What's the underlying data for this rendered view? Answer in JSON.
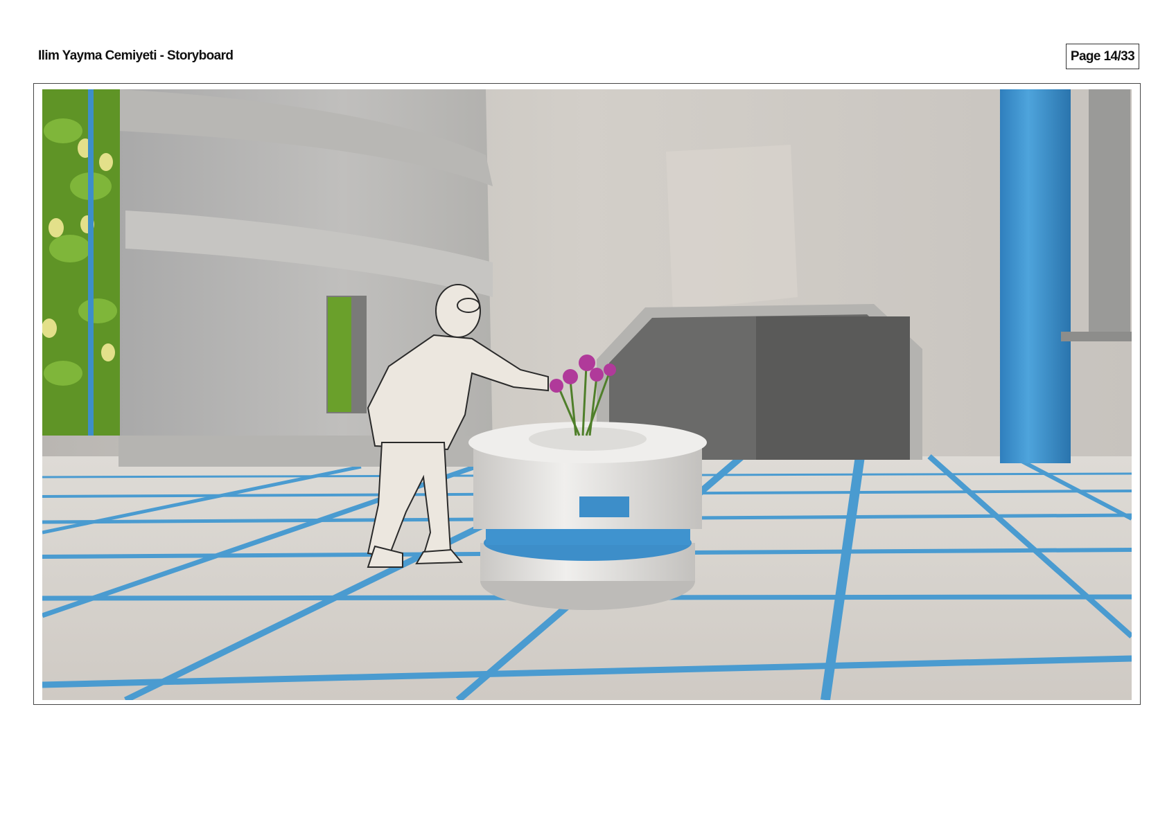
{
  "header": {
    "title": "Ilim Yayma Cemiyeti - Storyboard",
    "page_indicator": "Page 14/33"
  },
  "panel": {
    "colors": {
      "wall": "#cfcac3",
      "floor": "#d8d4cf",
      "floor_lines": "#4a9bd0",
      "pillar": "#3d8ec9",
      "foliage": "#6fa52b",
      "flower": "#b03a9a",
      "figure": "#ece7df"
    }
  }
}
